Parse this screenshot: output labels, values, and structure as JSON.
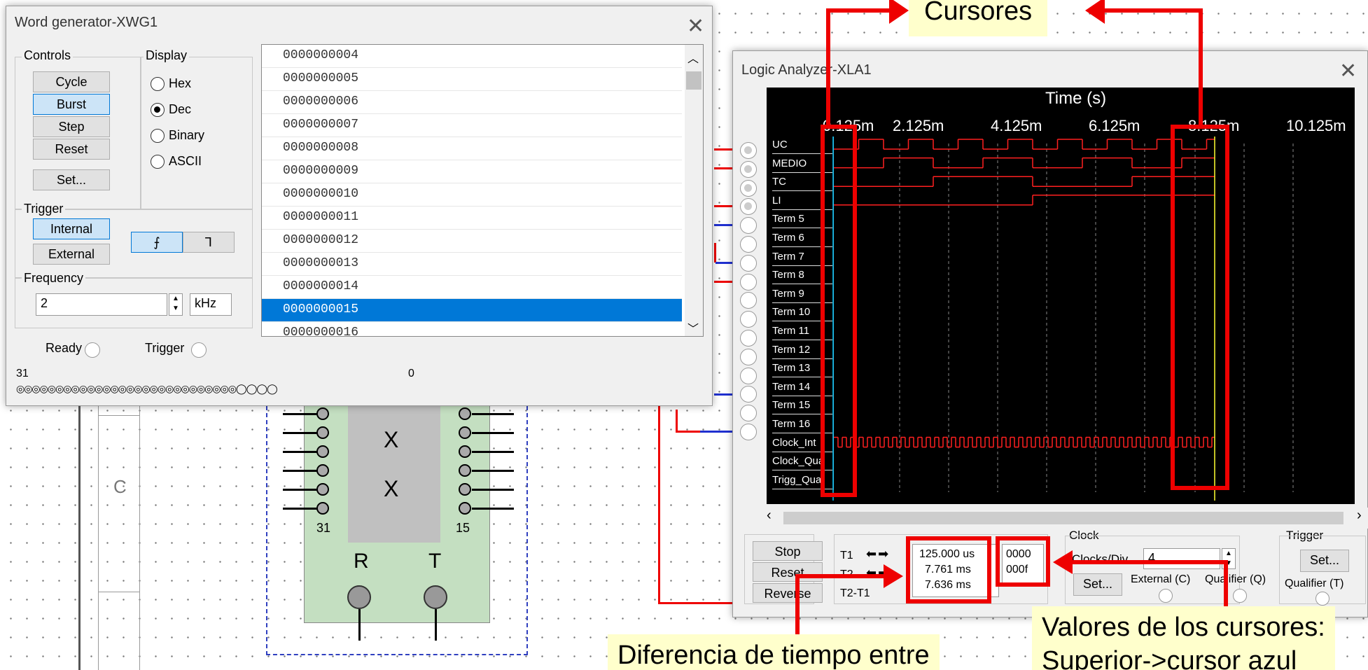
{
  "word_generator": {
    "title": "Word generator-XWG1",
    "controls_label": "Controls",
    "display_label": "Display",
    "buttons": {
      "cycle": "Cycle",
      "burst": "Burst",
      "step": "Step",
      "reset": "Reset",
      "set": "Set..."
    },
    "display_options": {
      "hex": "Hex",
      "dec": "Dec",
      "binary": "Binary",
      "ascii": "ASCII"
    },
    "selected_display": "Dec",
    "trigger_label": "Trigger",
    "trigger_buttons": {
      "internal": "Internal",
      "external": "External"
    },
    "frequency_label": "Frequency",
    "frequency_value": "2",
    "frequency_unit": "kHz",
    "ready_label": "Ready",
    "trigger_status_label": "Trigger",
    "bit_high": "31",
    "bit_low": "0",
    "words": [
      "0000000004",
      "0000000005",
      "0000000006",
      "0000000007",
      "0000000008",
      "0000000009",
      "0000000010",
      "0000000011",
      "0000000012",
      "0000000013",
      "0000000014",
      "0000000015",
      "0000000016"
    ],
    "selected_word": "0000000015"
  },
  "logic_analyzer": {
    "title": "Logic Analyzer-XLA1",
    "time_label": "Time (s)",
    "time_ticks": [
      "0.125m",
      "2.125m",
      "4.125m",
      "6.125m",
      "8.125m",
      "10.125m"
    ],
    "channels": [
      "UC",
      "MEDIO",
      "TC",
      "LI",
      "Term 5",
      "Term 6",
      "Term 7",
      "Term 8",
      "Term 9",
      "Term 10",
      "Term 11",
      "Term 12",
      "Term 13",
      "Term 14",
      "Term 15",
      "Term 16",
      "Clock_Int",
      "Clock_Qua",
      "Trigg_Qua"
    ],
    "buttons": {
      "stop": "Stop",
      "reset": "Reset",
      "reverse": "Reverse"
    },
    "cursor_labels": {
      "t1": "T1",
      "t2": "T2",
      "diff": "T2-T1"
    },
    "cursor_times": {
      "t1": "125.000 us",
      "t2": "7.761 ms",
      "diff": "7.636 ms"
    },
    "cursor_values": {
      "t1": "0000",
      "t2": "000f"
    },
    "clock_label": "Clock",
    "clocks_div_label": "Clocks/Div",
    "clocks_div_value": "4",
    "clock_set": "Set...",
    "external_label": "External (C)",
    "qualifier_label": "Qualifier (Q)",
    "trigger_label": "Trigger",
    "trigger_set": "Set...",
    "trigger_qualifier_label": "Qualifier (T)",
    "waveform_color": "#ff2020",
    "cursor1_color": "#00c8ff",
    "cursor2_color": "#ffff30"
  },
  "schematic": {
    "row_label": "C",
    "chip_marks": [
      "X",
      "X"
    ],
    "pin_31": "31",
    "pin_15": "15",
    "r_label": "R",
    "t_label": "T"
  },
  "annotations": {
    "cursores": "Cursores",
    "diferencia": "Diferencia de tiempo entre",
    "valores": "Valores de los cursores:",
    "superior": "Superior->cursor azul"
  }
}
